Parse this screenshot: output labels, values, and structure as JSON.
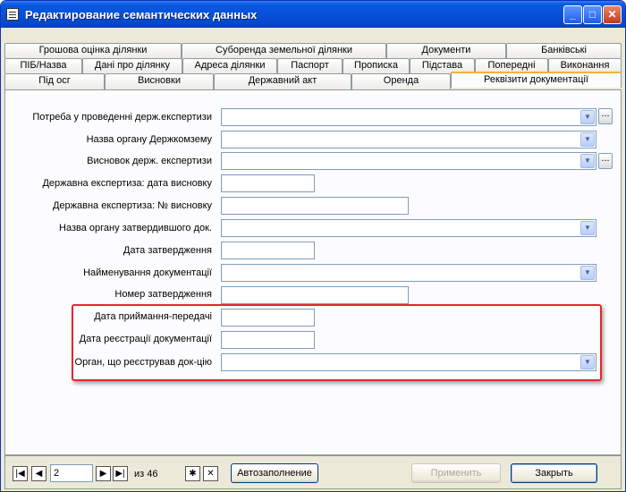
{
  "window": {
    "title": "Редактирование семантических данных",
    "buttons": {
      "minimize": "_",
      "maximize": "□",
      "close": "✕"
    }
  },
  "tabs": {
    "row1": [
      "Грошова оцінка ділянки",
      "Суборенда земельної ділянки",
      "Документи",
      "Банківські"
    ],
    "row2": [
      "ПІБ/Назва",
      "Дані про ділянку",
      "Адреса ділянки",
      "Паспорт",
      "Прописка",
      "Підстава",
      "Попередні",
      "Виконання"
    ],
    "row3": [
      "Під осг",
      "Висновки",
      "Державний акт",
      "Оренда",
      "Реквізити документації"
    ],
    "active": "Реквізити документації"
  },
  "form": {
    "fields": [
      {
        "label": "Потреба у проведенні держ.експертизи",
        "type": "combo",
        "value": "",
        "has_browse": true
      },
      {
        "label": "Назва органу Держкомзему",
        "type": "combo",
        "value": ""
      },
      {
        "label": "Висновок держ. експертизи",
        "type": "combo",
        "value": "",
        "has_browse": true
      },
      {
        "label": "Державна експертиза: дата висновку",
        "type": "text",
        "value": ""
      },
      {
        "label": "Державна експертиза: № висновку",
        "type": "text",
        "value": ""
      },
      {
        "label": "Назва органу затвердившого док.",
        "type": "combo",
        "value": ""
      },
      {
        "label": "Дата затвердження",
        "type": "text",
        "value": ""
      },
      {
        "label": "Найменування документації",
        "type": "combo",
        "value": ""
      },
      {
        "label": "Номер затвердження",
        "type": "text",
        "value": ""
      },
      {
        "label": "Дата приймання-передачі",
        "type": "text",
        "value": ""
      },
      {
        "label": "Дата реєстрації документації",
        "type": "text",
        "value": ""
      },
      {
        "label": "Орган, що реєстрував док-цію",
        "type": "combo",
        "value": ""
      }
    ],
    "browse_label": "...",
    "highlight_color": "#e8262b"
  },
  "navigation": {
    "current_record": "2",
    "of_label": "из 46",
    "first": "|◀",
    "prev": "◀",
    "next": "▶",
    "last": "▶|",
    "new_record": "✱",
    "delete_record": "✕"
  },
  "buttons": {
    "autofill": "Автозаполнение",
    "apply": "Применить",
    "close": "Закрыть"
  },
  "icons": {
    "dropdown": "chevron-down-icon",
    "app": "form-icon"
  }
}
